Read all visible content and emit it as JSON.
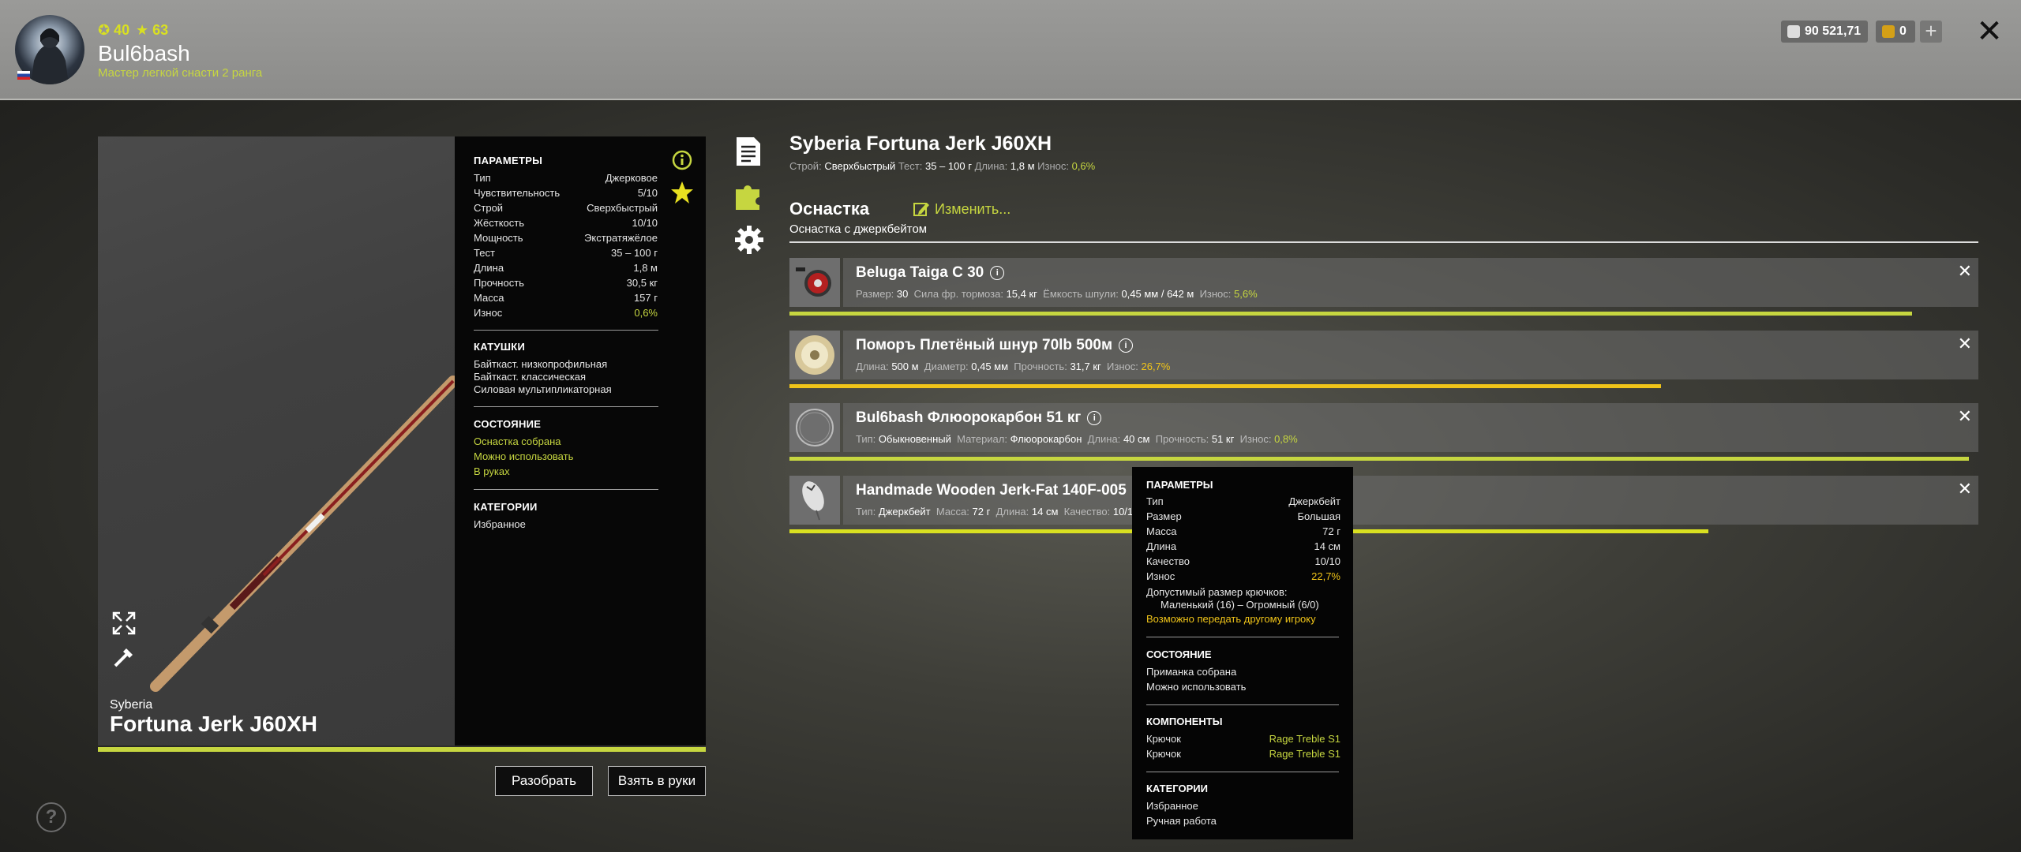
{
  "header": {
    "level": "40",
    "stars": "63",
    "username": "Bul6bash",
    "rank": "Мастер легкой снасти 2 ранга",
    "silver": "90 521,71",
    "gold": "0",
    "plus": "+",
    "close": "✕"
  },
  "rod": {
    "brand": "Syberia",
    "name": "Fortuna Jerk J60XH",
    "params_heading": "ПАРАМЕТРЫ",
    "params": [
      {
        "label": "Тип",
        "value": "Джерковое"
      },
      {
        "label": "Чувствительность",
        "value": "5/10"
      },
      {
        "label": "Строй",
        "value": "Сверхбыстрый"
      },
      {
        "label": "Жёсткость",
        "value": "10/10"
      },
      {
        "label": "Мощность",
        "value": "Экстратяжёлое"
      },
      {
        "label": "Тест",
        "value": "35 – 100 г"
      },
      {
        "label": "Длина",
        "value": "1,8 м"
      },
      {
        "label": "Прочность",
        "value": "30,5 кг"
      },
      {
        "label": "Масса",
        "value": "157 г"
      },
      {
        "label": "Износ",
        "value": "0,6%"
      }
    ],
    "reels_heading": "КАТУШКИ",
    "reels": [
      "Байткаст. низкопрофильная",
      "Байткаст. классическая",
      "Силовая мультипликаторная"
    ],
    "state_heading": "СОСТОЯНИЕ",
    "states": [
      "Оснастка собрана",
      "Можно использовать",
      "В руках"
    ],
    "cat_heading": "КАТЕГОРИИ",
    "categories": [
      "Избранное"
    ],
    "wear_fraction": 1.0
  },
  "buttons": {
    "disassemble": "Разобрать",
    "take": "Взять в руки"
  },
  "item": {
    "title": "Syberia Fortuna Jerk J60XH",
    "sub": {
      "l1": "Строй:",
      "v1": "Сверхбыстрый",
      "l2": "Тест:",
      "v2": "35 – 100 г",
      "l3": "Длина:",
      "v3": "1,8 м",
      "l4": "Износ:",
      "v4": "0,6%"
    }
  },
  "rigging": {
    "title": "Оснастка",
    "edit": "Изменить...",
    "subtitle": "Оснастка с джеркбейтом",
    "rows": [
      {
        "title": "Beluga Taiga C 30",
        "info": [
          [
            "Размер:",
            "30"
          ],
          [
            "Сила фр. тормоза:",
            "15,4 кг"
          ],
          [
            "Ёмкость шпули:",
            "0,45 мм / 642 м"
          ]
        ],
        "wear_label": "Износ:",
        "wear": "5,6%",
        "bar": 0.944,
        "bar_color": "#c6d640"
      },
      {
        "title": "Поморъ Плетёный шнур 70lb 500м",
        "info": [
          [
            "Длина:",
            "500 м"
          ],
          [
            "Диаметр:",
            "0,45 мм"
          ],
          [
            "Прочность:",
            "31,7 кг"
          ]
        ],
        "wear_label": "Износ:",
        "wear": "26,7%",
        "bar": 0.733,
        "bar_color": "#f0c419"
      },
      {
        "title": "Bul6bash Флюорокарбон 51 кг",
        "info": [
          [
            "Тип:",
            "Обыкновенный"
          ],
          [
            "Материал:",
            "Флюорокарбон"
          ],
          [
            "Длина:",
            "40 см"
          ],
          [
            "Прочность:",
            "51 кг"
          ]
        ],
        "wear_label": "Износ:",
        "wear": "0,8%",
        "bar": 0.992,
        "bar_color": "#c6d640"
      },
      {
        "title": "Handmade Wooden Jerk-Fat 140F-005",
        "info": [
          [
            "Тип:",
            "Джеркбейт"
          ],
          [
            "Масса:",
            "72 г"
          ],
          [
            "Длина:",
            "14 см"
          ],
          [
            "Качество:",
            "10/10"
          ]
        ],
        "wear_label": "",
        "wear": "",
        "bar": 0.773,
        "bar_color": "#d9e021"
      }
    ],
    "remove": "✕"
  },
  "tooltip": {
    "params_heading": "ПАРАМЕТРЫ",
    "params": [
      {
        "label": "Тип",
        "value": "Джеркбейт"
      },
      {
        "label": "Размер",
        "value": "Большая"
      },
      {
        "label": "Масса",
        "value": "72 г"
      },
      {
        "label": "Длина",
        "value": "14 см"
      },
      {
        "label": "Качество",
        "value": "10/10"
      },
      {
        "label": "Износ",
        "value": "22,7%"
      }
    ],
    "hook_size_label": "Допустимый размер крючков:",
    "hook_size_value": "Маленький (16) – Огромный (6/0)",
    "transfer": "Возможно передать другому игроку",
    "state_heading": "СОСТОЯНИЕ",
    "states": [
      "Приманка собрана",
      "Можно использовать"
    ],
    "comp_heading": "КОМПОНЕНТЫ",
    "components": [
      {
        "label": "Крючок",
        "value": "Rage Treble S1"
      },
      {
        "label": "Крючок",
        "value": "Rage Treble S1"
      }
    ],
    "cat_heading": "КАТЕГОРИИ",
    "categories": [
      "Избранное",
      "Ручная работа"
    ]
  },
  "help": "?",
  "colors": {
    "accent": "#c6d640",
    "warn": "#f0c419"
  }
}
